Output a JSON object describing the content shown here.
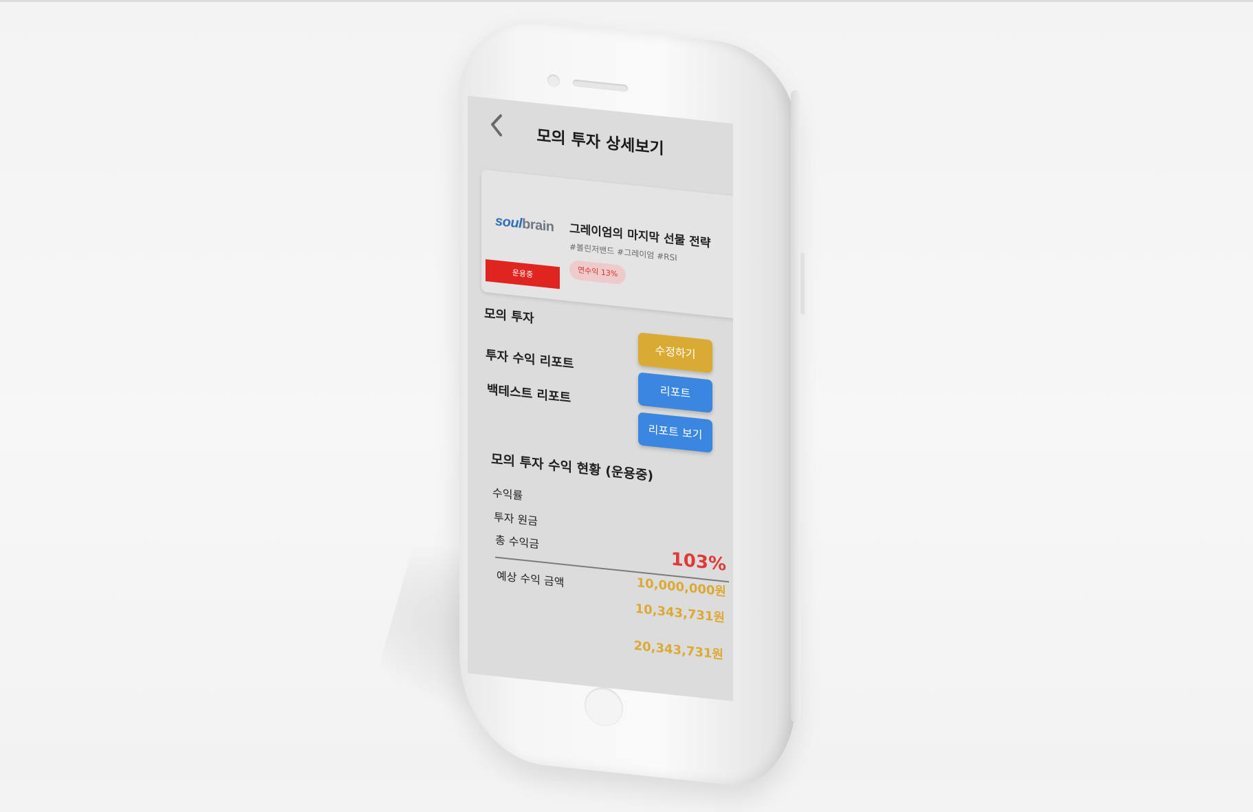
{
  "header": {
    "title": "모의 투자 상세보기"
  },
  "strategy": {
    "logo_part1": "soul",
    "logo_part2": "brain",
    "status": "운용중",
    "title": "그레이엄의 마지막 선물 전략",
    "tags": "#볼린저밴드 #그레이엄 #RSI",
    "annual_return": "연수익 13%"
  },
  "sections": {
    "mock_investment": "모의 투자",
    "profit_report": "투자 수익 리포트",
    "backtest_report": "백테스트 리포트"
  },
  "buttons": {
    "edit": "수정하기",
    "report": "리포트",
    "view_report": "리포트 보기"
  },
  "summary": {
    "title": "모의 투자 수익 현황 (운용중)",
    "labels": {
      "return_rate": "수익률",
      "principal": "투자 원금",
      "total_profit": "총 수익금",
      "expected_amount": "예상 수익 금액"
    },
    "values": {
      "return_rate": "103%",
      "principal": "10,000,000원",
      "total_profit": "10,343,731원",
      "expected_amount": "20,343,731원"
    }
  },
  "colors": {
    "status_red": "#e0241f",
    "edit_button": "#d9ab33",
    "report_button": "#3b86df",
    "rate_red": "#e0393a",
    "money_gold": "#dda935"
  }
}
